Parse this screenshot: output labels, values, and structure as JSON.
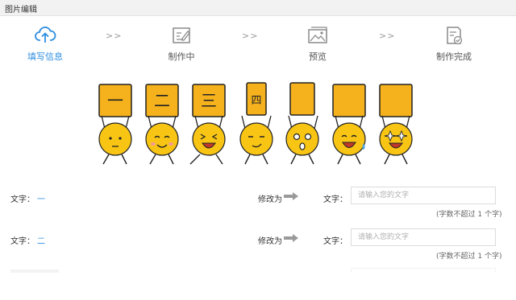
{
  "window": {
    "title": "图片编辑"
  },
  "steps": [
    {
      "label": "填写信息",
      "icon": "cloud-upload-icon",
      "active": true
    },
    {
      "label": "制作中",
      "icon": "edit-document-icon",
      "active": false
    },
    {
      "label": "预览",
      "icon": "image-preview-icon",
      "active": false
    },
    {
      "label": "制作完成",
      "icon": "document-check-icon",
      "active": false
    }
  ],
  "step_separator": ">>",
  "emoji": {
    "signs": [
      "一",
      "二",
      "三",
      "四",
      "",
      "",
      ""
    ],
    "colors": {
      "sign": "#f5b21c",
      "face": "#f8c515",
      "stroke": "#222222"
    }
  },
  "form": {
    "rows": [
      {
        "label": "文字：",
        "value": "一",
        "modify": "修改为",
        "new_label": "文字：",
        "placeholder": "请输入您的文字",
        "hint": "(字数不超过 1 个字)"
      },
      {
        "label": "文字：",
        "value": "二",
        "modify": "修改为",
        "new_label": "文字：",
        "placeholder": "请输入您的文字",
        "hint": "(字数不超过 1 个字)"
      }
    ]
  },
  "accent_color": "#2f8fe0"
}
